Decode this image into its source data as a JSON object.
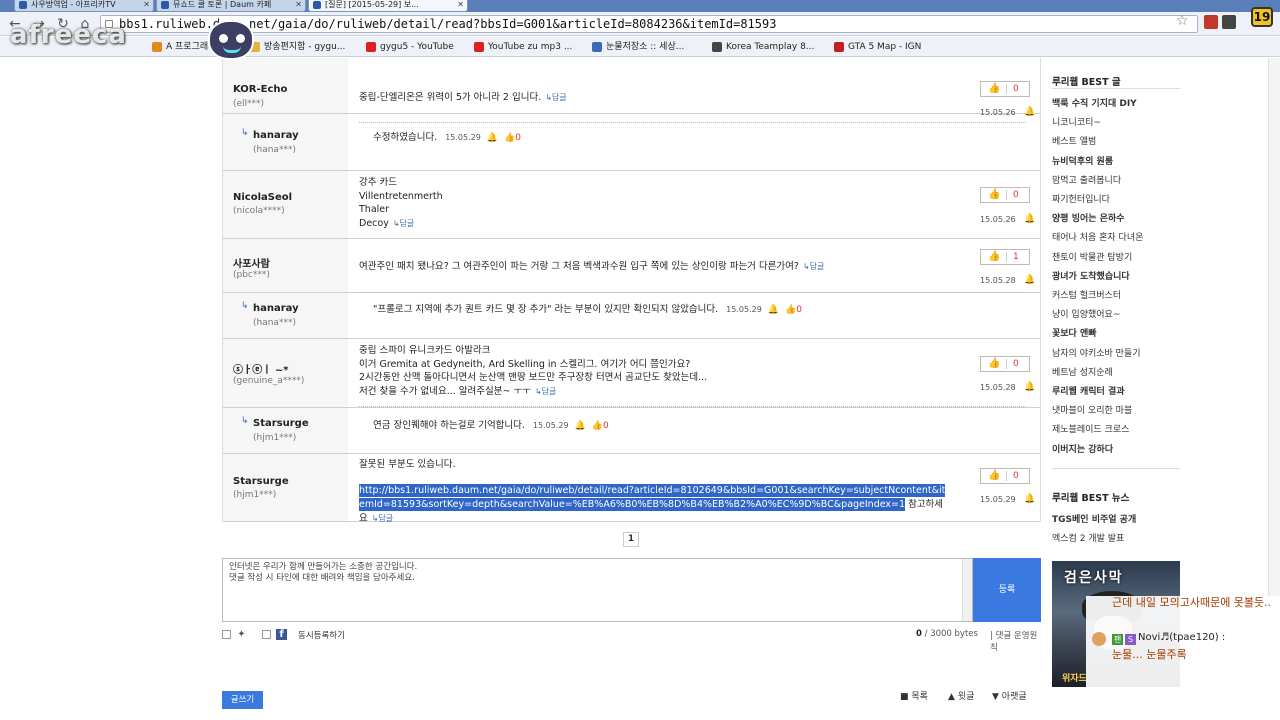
{
  "browser": {
    "tabs": [
      {
        "label": "사우방역업 - 아프리카TV"
      },
      {
        "label": "뮤쇼드 쿨 토론 | Daum 카페"
      },
      {
        "label": "[질문] [2015-05-29] 보..."
      }
    ],
    "url_host": "bbs1.ruliweb.daum.net",
    "url_path": "/gaia/do/ruliweb/detail/read?bbsId=G001&articleId=8084236&itemId=81593",
    "badge": "19",
    "bookmarks": [
      {
        "label": "A 프로그래머",
        "color": "#e08a1c"
      },
      {
        "label": "방송편지함 - gygu...",
        "color": "#e2b43a"
      },
      {
        "label": "gygu5 - YouTube",
        "color": "#e02020"
      },
      {
        "label": "YouTube zu mp3 ...",
        "color": "#e02020"
      },
      {
        "label": "눈물저장소 :: 세상...",
        "color": "#3a6ab8"
      },
      {
        "label": "Korea Teamplay 8...",
        "color": "#444444"
      },
      {
        "label": "GTA 5 Map - IGN",
        "color": "#c02020"
      }
    ]
  },
  "watermark": "afreeca",
  "comments": [
    {
      "name": "KOR-Echo",
      "id": "(ell***)",
      "lines": [
        "중립-단엘리온은 위력이 5가 아니라 2 입니다."
      ],
      "reply_label": "답글",
      "likes": "0",
      "date": "15.05.26"
    },
    {
      "reply": true,
      "name": "hanaray",
      "id": "(hana***)",
      "text": "수정하였습니다.",
      "date": "15.05.29",
      "likes": "0"
    },
    {
      "name": "NicolaSeol",
      "id": "(nicola****)",
      "lines": [
        "강추 카드",
        "Villentretenmerth",
        "Thaler",
        "Decoy"
      ],
      "reply_label": "답글",
      "likes": "0",
      "date": "15.05.26"
    },
    {
      "name": "사포사람",
      "id": "(pbc***)",
      "lines": [
        "여관주인 패치 됐나요? 그 여관주인이 파는 거랑 그 처음 벡색과수원 입구 쪽에 있는 상인이랑 파는거 다른가여?"
      ],
      "reply_label": "답글",
      "likes": "1",
      "date": "15.05.28"
    },
    {
      "reply": true,
      "name": "hanaray",
      "id": "(hana***)",
      "text": "\"프롤로그 지역에 추가 퀀트 카드 몇 장 추가\" 라는 부분이 있지만 확인되지 않았습니다.",
      "date": "15.05.29",
      "likes": "0"
    },
    {
      "name": "ⓢㅏⓔㅣ ~*",
      "id": "(genuine_a****)",
      "lines": [
        "중립 스파이 유니크카드 아발라크",
        "이거 Gremita at Gedyneith, Ard Skelling in 스켈리그. 여기가 어디 쯤인가요?",
        "2시간동안 산맥 돌아다니면서 눈산맥 맨땅 보드만 주구장창 터면서 곰교단도 찾았는데...",
        "저건 찾을 수가 없네요... 알려주실분~ ㅜㅜ"
      ],
      "reply_label": "답글",
      "likes": "0",
      "date": "15.05.28"
    },
    {
      "reply": true,
      "name": "Starsurge",
      "id": "(hjm1***)",
      "text": "연금 장인퀘해야 하는걸로 기억합니다.",
      "date": "15.05.29",
      "likes": "0"
    },
    {
      "name": "Starsurge",
      "id": "(hjm1***)",
      "lines": [
        "잘못된 부분도 있습니다."
      ],
      "link": "http://bbs1.ruliweb.daum.net/gaia/do/ruliweb/detail/read?articleId=8102649&bbsId=G001&searchKey=subjectNcontent&itemId=81593&sortKey=depth&searchValue=%EB%A6%B0%EB%8D%B4%EB%B2%A0%EC%9D%BC&pageIndex=1",
      "link_suffix": "참고하세요",
      "reply_label": "답글",
      "likes": "0",
      "date": "15.05.29"
    }
  ],
  "pager": {
    "current": "1"
  },
  "editor": {
    "placeholder": "인터넷은 우리가 함께 만들어가는 소중한 공간입니다.\n댓글 작성 시 타인에 대한 배려와 책임을 담아주세요.",
    "submit_label": "등록",
    "simul_label": "동시등록하기",
    "bytes_current": "0",
    "bytes_max": "/ 3000 bytes",
    "policy_label": "댓글 운영원칙"
  },
  "footer": {
    "write_label": "글쓰기",
    "list_label": "목록",
    "up_label": "윗글",
    "down_label": "아랫글"
  },
  "sidebar": {
    "best_title": "루리웹 BEST 글",
    "best_items": [
      {
        "label": "백룩 수직 기지대 DIY",
        "bold": true
      },
      {
        "label": "니코니코티~",
        "bold": false
      },
      {
        "label": "베스트 앨범",
        "bold": false
      },
      {
        "label": "뉴비덕후의 원룸",
        "bold": true
      },
      {
        "label": "맘먹고 출려봅니다",
        "bold": false
      },
      {
        "label": "짜기헌터입니다",
        "bold": false
      },
      {
        "label": "양평 빙어는 은하수",
        "bold": true
      },
      {
        "label": "태어나 처음 혼자 다녀온",
        "bold": false
      },
      {
        "label": "챈토이 박물관 탐방기",
        "bold": false
      },
      {
        "label": "광녀가 도착했습니다",
        "bold": true
      },
      {
        "label": "커스텀 헐크버스터",
        "bold": false
      },
      {
        "label": "냥이 입양했어요~",
        "bold": false
      },
      {
        "label": "꽃보다 앤빠",
        "bold": true
      },
      {
        "label": "남자의 야키소바 만들기",
        "bold": false
      },
      {
        "label": "베트남 성지순례",
        "bold": false
      },
      {
        "label": "루리웹 캐릭터 결과",
        "bold": true
      },
      {
        "label": "냇마블이 오리한 마블",
        "bold": false
      },
      {
        "label": "제노블레이드 크로스",
        "bold": false
      },
      {
        "label": "이버지는 강하다",
        "bold": true
      }
    ],
    "news_title": "루리웹 BEST 뉴스",
    "news_items": [
      {
        "label": "TGS베인 비주얼 공개",
        "bold": true
      },
      {
        "label": "엑스컴 2 개발 발표",
        "bold": false
      }
    ],
    "banner_title": "검은사막",
    "banner_sub": "위자드"
  },
  "chat": {
    "line1": "근데 내일 모의고사때문에 못볼듯..",
    "nick": "Novi♬(tpae120) :",
    "line2": "눈물... 눈물주록"
  }
}
